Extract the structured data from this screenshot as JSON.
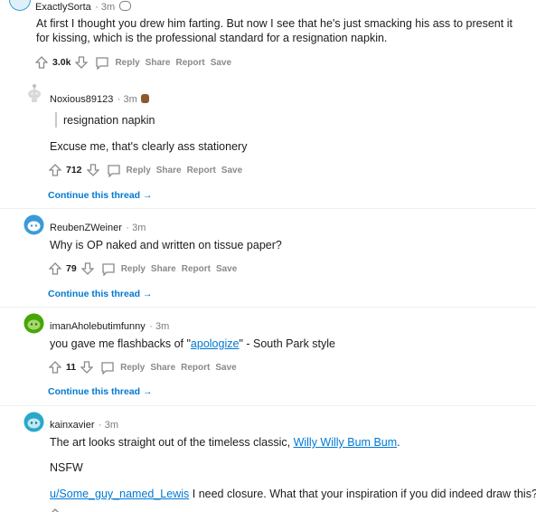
{
  "comments": [
    {
      "user": "ExactlySorta",
      "time": "· 3m",
      "text": "At first I thought you drew him farting. But now I see that he's just smacking his ass to present it for kissing, which is the professional standard for a resignation napkin.",
      "votes": "3.0k"
    },
    {
      "user": "Noxious89123",
      "time": "· 3m",
      "quote": "resignation napkin",
      "text": "Excuse me, that's clearly ass stationery",
      "votes": "712",
      "continue": "Continue this thread →"
    },
    {
      "user": "ReubenZWeiner",
      "time": "· 3m",
      "text": "Why is OP naked and written on tissue paper?",
      "votes": "79",
      "continue": "Continue this thread →"
    },
    {
      "user": "imanAholebutimfunny",
      "time": "· 3m",
      "text_before": "you gave me flashbacks of \"",
      "text_link": "apologize",
      "text_after": "\" - South Park style",
      "votes": "11",
      "continue": "Continue this thread →"
    },
    {
      "user": "kainxavier",
      "time": "· 3m",
      "text_before": "The art looks straight out of the timeless classic, ",
      "text_link": "Willy Willy Bum Bum",
      "text_after": ".",
      "line2": "NSFW",
      "line3_link": "u/Some_guy_named_Lewis",
      "line3_after": " I need closure. What that your inspiration if you did indeed draw this?"
    }
  ],
  "actions": {
    "reply": "Reply",
    "share": "Share",
    "report": "Report",
    "save": "Save"
  },
  "colors": {
    "accent": "#0079d3",
    "meta": "#7c7c7c",
    "action": "#878a8c",
    "avatar_blue": "#3b9bd8",
    "avatar_green": "#46a508"
  }
}
